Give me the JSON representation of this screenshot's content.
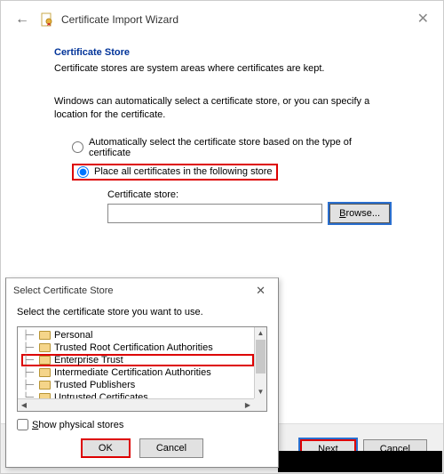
{
  "wizard": {
    "title": "Certificate Import Wizard",
    "section_title": "Certificate Store",
    "section_desc": "Certificate stores are system areas where certificates are kept.",
    "body_text": "Windows can automatically select a certificate store, or you can specify a location for the certificate.",
    "radio_auto": "Automatically select the certificate store based on the type of certificate",
    "radio_place": "Place all certificates in the following store",
    "store_label": "Certificate store:",
    "store_value": "",
    "browse": "rowse...",
    "browse_accel": "B",
    "next": "ext",
    "next_accel": "N",
    "cancel": "Cancel"
  },
  "dialog": {
    "title": "Select Certificate Store",
    "instruction": "Select the certificate store you want to use.",
    "items": [
      "Personal",
      "Trusted Root Certification Authorities",
      "Enterprise Trust",
      "Intermediate Certification Authorities",
      "Trusted Publishers",
      "Untrusted Certificates"
    ],
    "show_physical": "how physical stores",
    "show_physical_accel": "S",
    "ok": "OK",
    "cancel": "Cancel"
  }
}
